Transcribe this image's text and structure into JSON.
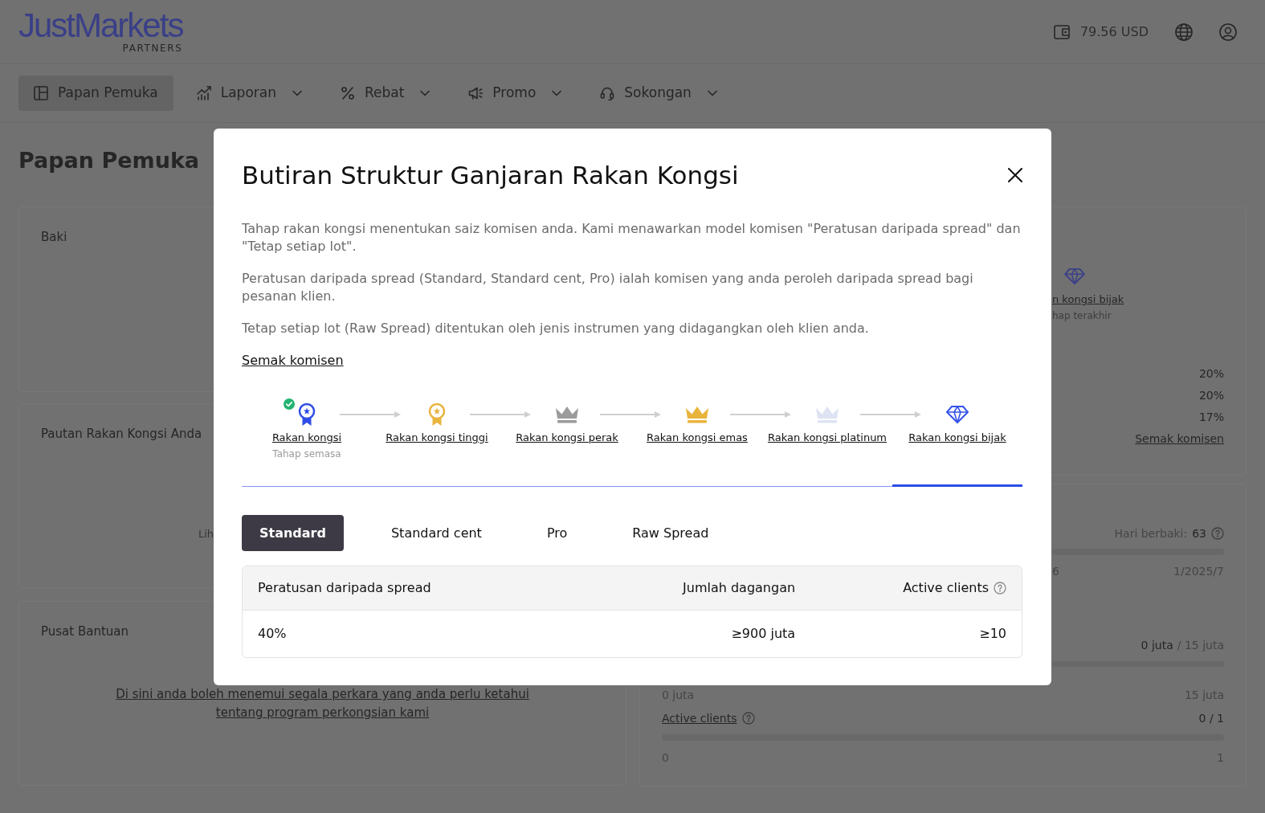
{
  "header": {
    "logo": "JustMarkets",
    "logo_tagline": "PARTNERS",
    "balance": "79.56 USD"
  },
  "nav": [
    {
      "label": "Papan Pemuka",
      "selected": true,
      "dropdown": false
    },
    {
      "label": "Laporan",
      "selected": false,
      "dropdown": true
    },
    {
      "label": "Rebat",
      "selected": false,
      "dropdown": true
    },
    {
      "label": "Promo",
      "selected": false,
      "dropdown": true
    },
    {
      "label": "Sokongan",
      "selected": false,
      "dropdown": true
    }
  ],
  "page_title": "Papan Pemuka",
  "balance_card": {
    "title": "Baki"
  },
  "link_card": {
    "title": "Pautan Rakan Kongsi Anda",
    "text": "Lih"
  },
  "help_card": {
    "title": "Pusat Bantuan",
    "link": "Di sini anda boleh menemui segala perkara yang anda perlu ketahui tentang program perkongsian kami"
  },
  "level_card": {
    "level_name": "n kongsi bijak",
    "level_note": "hap terakhir",
    "rates": [
      "20%",
      "20%",
      "17%"
    ],
    "link": "Semak komisen"
  },
  "progress_card": {
    "days_label": "Hari berbaki:",
    "days_value": "63",
    "period": {
      "start": "6",
      "end": "1/2025/7"
    },
    "volume": {
      "value": "0 juta",
      "target": "/ 15 juta",
      "min": "0 juta",
      "max": "15 juta"
    },
    "clients": {
      "label": "Active clients",
      "value": "0 / 1",
      "min": "0",
      "max": "1"
    }
  },
  "modal": {
    "title": "Butiran Struktur Ganjaran Rakan Kongsi",
    "paragraphs": [
      "Tahap rakan kongsi menentukan saiz komisen anda. Kami menawarkan model komisen \"Peratusan daripada spread\" dan \"Tetap setiap lot\".",
      "Peratusan daripada spread (Standard, Standard cent, Pro) ialah komisen yang anda peroleh daripada spread bagi pesanan klien.",
      "Tetap setiap lot (Raw Spread) ditentukan oleh jenis instrumen yang didagangkan oleh klien anda."
    ],
    "link": "Semak komisen",
    "steps": [
      {
        "label": "Rakan kongsi",
        "note": "Tahap semasa",
        "kind": "rosette",
        "color": "#2f4de6",
        "current": true,
        "selected": false
      },
      {
        "label": "Rakan kongsi tinggi",
        "kind": "rosette",
        "color": "#e9b43c",
        "current": false,
        "selected": false
      },
      {
        "label": "Rakan kongsi perak",
        "kind": "crown",
        "color": "#9b9b9b",
        "current": false,
        "selected": false
      },
      {
        "label": "Rakan kongsi emas",
        "kind": "crown",
        "color": "#e9b43c",
        "current": false,
        "selected": false
      },
      {
        "label": "Rakan kongsi platinum",
        "kind": "crown",
        "color": "#dde3f2",
        "current": false,
        "selected": false
      },
      {
        "label": "Rakan kongsi bijak",
        "kind": "diamond",
        "color": "#3553e8",
        "current": false,
        "selected": true
      }
    ],
    "tabs": [
      {
        "label": "Standard",
        "selected": true
      },
      {
        "label": "Standard cent",
        "selected": false
      },
      {
        "label": "Pro",
        "selected": false
      },
      {
        "label": "Raw Spread",
        "selected": false
      }
    ],
    "table": {
      "columns": [
        {
          "label": "Peratusan daripada spread",
          "help": false
        },
        {
          "label": "Jumlah dagangan",
          "help": false
        },
        {
          "label": "Active clients",
          "help": true
        }
      ],
      "rows": [
        [
          "40%",
          "≥900 juta",
          "≥10"
        ]
      ]
    }
  }
}
